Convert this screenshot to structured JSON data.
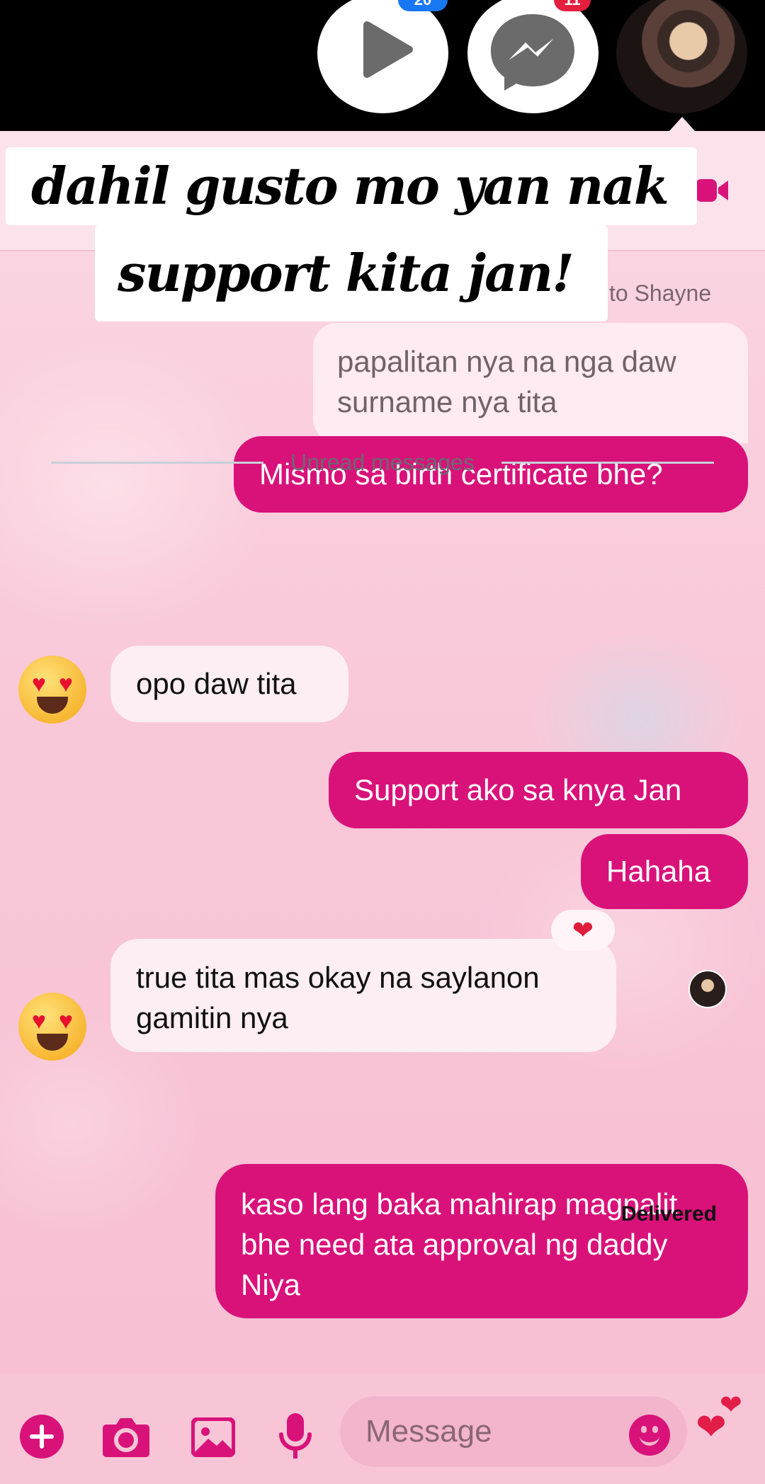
{
  "overlay": {
    "bubble_badges": [
      {
        "label": "20"
      },
      {
        "label": "11"
      }
    ],
    "caption_line1": "dahil gusto mo yan  nak",
    "caption_line2": "support kita jan!"
  },
  "chat": {
    "reply_context": "to Shayne",
    "replied_message": "papalitan nya na nga daw surname nya tita",
    "unread_label": "Unread messages",
    "messages": [
      {
        "direction": "out",
        "text": "Mismo sa birth certificate bhe?"
      },
      {
        "direction": "in",
        "text": "opo daw tita"
      },
      {
        "direction": "out",
        "text": "Support ako sa knya Jan"
      },
      {
        "direction": "out",
        "text": "Hahaha"
      },
      {
        "direction": "in",
        "text": "true tita mas okay na saylanon gamitin nya",
        "reaction": "❤"
      },
      {
        "direction": "out",
        "text": "kaso lang baka mahirap magpalit bhe  need ata approval ng daddy Niya"
      }
    ],
    "status": "Delivered"
  },
  "composer": {
    "placeholder": "Message",
    "icons": [
      "add-icon",
      "camera-icon",
      "gallery-icon",
      "microphone-icon",
      "emoji-icon",
      "hearts-icon"
    ]
  },
  "colors": {
    "accent": "#d9127a",
    "incoming_bubble": "#fdeef3",
    "background": "#f8c3d5"
  }
}
